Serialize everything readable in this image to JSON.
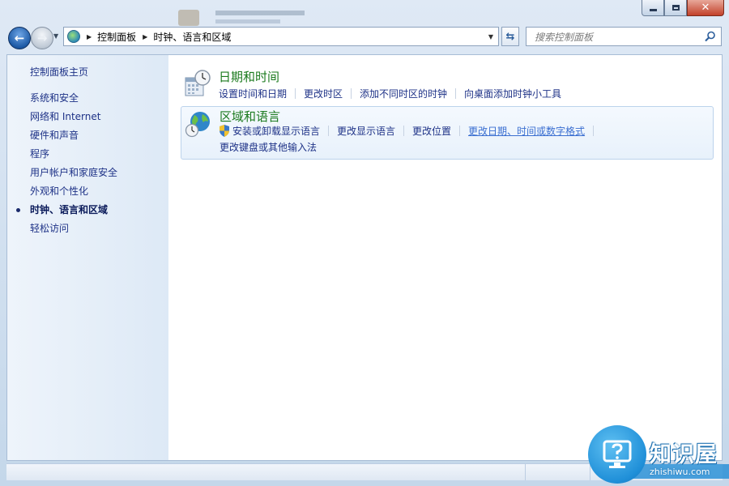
{
  "window": {
    "caption_buttons": [
      "minimize",
      "maximize",
      "close"
    ]
  },
  "navigation": {
    "breadcrumbs": [
      "控制面板",
      "时钟、语言和区域"
    ],
    "search_placeholder": "搜索控制面板"
  },
  "sidebar": {
    "home": "控制面板主页",
    "items": [
      {
        "label": "系统和安全",
        "active": false
      },
      {
        "label": "网络和 Internet",
        "active": false
      },
      {
        "label": "硬件和声音",
        "active": false
      },
      {
        "label": "程序",
        "active": false
      },
      {
        "label": "用户帐户和家庭安全",
        "active": false
      },
      {
        "label": "外观和个性化",
        "active": false
      },
      {
        "label": "时钟、语言和区域",
        "active": true
      },
      {
        "label": "轻松访问",
        "active": false
      }
    ]
  },
  "categories": [
    {
      "title": "日期和时间",
      "icon": "calendar-clock-icon",
      "links": [
        "设置时间和日期",
        "更改时区",
        "添加不同时区的时钟",
        "向桌面添加时钟小工具"
      ]
    },
    {
      "title": "区域和语言",
      "icon": "globe-clock-icon",
      "links": [
        "安装或卸载显示语言",
        "更改显示语言",
        "更改位置",
        "更改日期、时间或数字格式",
        "更改键盘或其他输入法"
      ]
    }
  ],
  "watermark": {
    "title": "知识屋",
    "subtitle": "zhishiwu.com"
  },
  "colors": {
    "link": "#1e3287",
    "category_title": "#1b7a1e",
    "sidebar_bg": "#e3edf8"
  }
}
